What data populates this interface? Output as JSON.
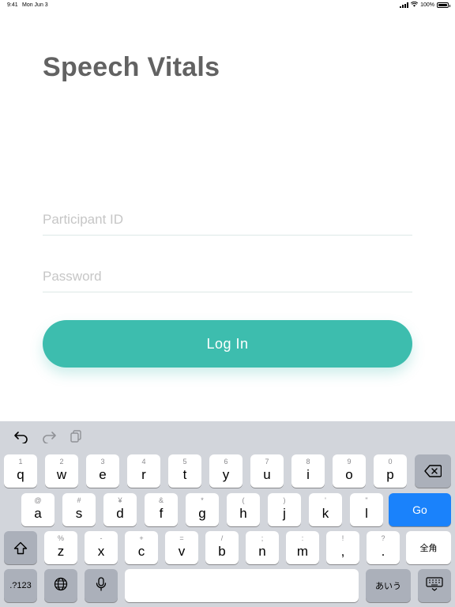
{
  "status_bar": {
    "time": "9:41",
    "date": "Mon Jun 3",
    "battery": "100%",
    "battery_level": 1.0
  },
  "app": {
    "title": "Speech Vitals"
  },
  "form": {
    "participant_id_placeholder": "Participant ID",
    "participant_id_value": "",
    "password_placeholder": "Password",
    "password_value": "",
    "login_label": "Log In"
  },
  "colors": {
    "accent": "#3dbdae",
    "title": "#626262",
    "keyboard_bg": "#d2d5db",
    "go_key": "#1a82fb"
  },
  "keyboard": {
    "toolbar_icons": [
      "undo-icon",
      "redo-icon",
      "paste-icon"
    ],
    "row1": [
      {
        "sub": "1",
        "main": "q"
      },
      {
        "sub": "2",
        "main": "w"
      },
      {
        "sub": "3",
        "main": "e"
      },
      {
        "sub": "4",
        "main": "r"
      },
      {
        "sub": "5",
        "main": "t"
      },
      {
        "sub": "6",
        "main": "y"
      },
      {
        "sub": "7",
        "main": "u"
      },
      {
        "sub": "8",
        "main": "i"
      },
      {
        "sub": "9",
        "main": "o"
      },
      {
        "sub": "0",
        "main": "p"
      }
    ],
    "row2": [
      {
        "sub": "@",
        "main": "a"
      },
      {
        "sub": "#",
        "main": "s"
      },
      {
        "sub": "¥",
        "main": "d"
      },
      {
        "sub": "&",
        "main": "f"
      },
      {
        "sub": "*",
        "main": "g"
      },
      {
        "sub": "(",
        "main": "h"
      },
      {
        "sub": ")",
        "main": "j"
      },
      {
        "sub": "'",
        "main": "k"
      },
      {
        "sub": "\"",
        "main": "l"
      }
    ],
    "row3": [
      {
        "sub": "%",
        "main": "z"
      },
      {
        "sub": "-",
        "main": "x"
      },
      {
        "sub": "+",
        "main": "c"
      },
      {
        "sub": "=",
        "main": "v"
      },
      {
        "sub": "/",
        "main": "b"
      },
      {
        "sub": ";",
        "main": "n"
      },
      {
        "sub": ":",
        "main": "m"
      },
      {
        "sub": "!",
        "main": ","
      },
      {
        "sub": "?",
        "main": "."
      }
    ],
    "go_label": "Go",
    "fullwidth_label": "全角",
    "numbers_label": ".?123",
    "kana_label": "あいう"
  }
}
